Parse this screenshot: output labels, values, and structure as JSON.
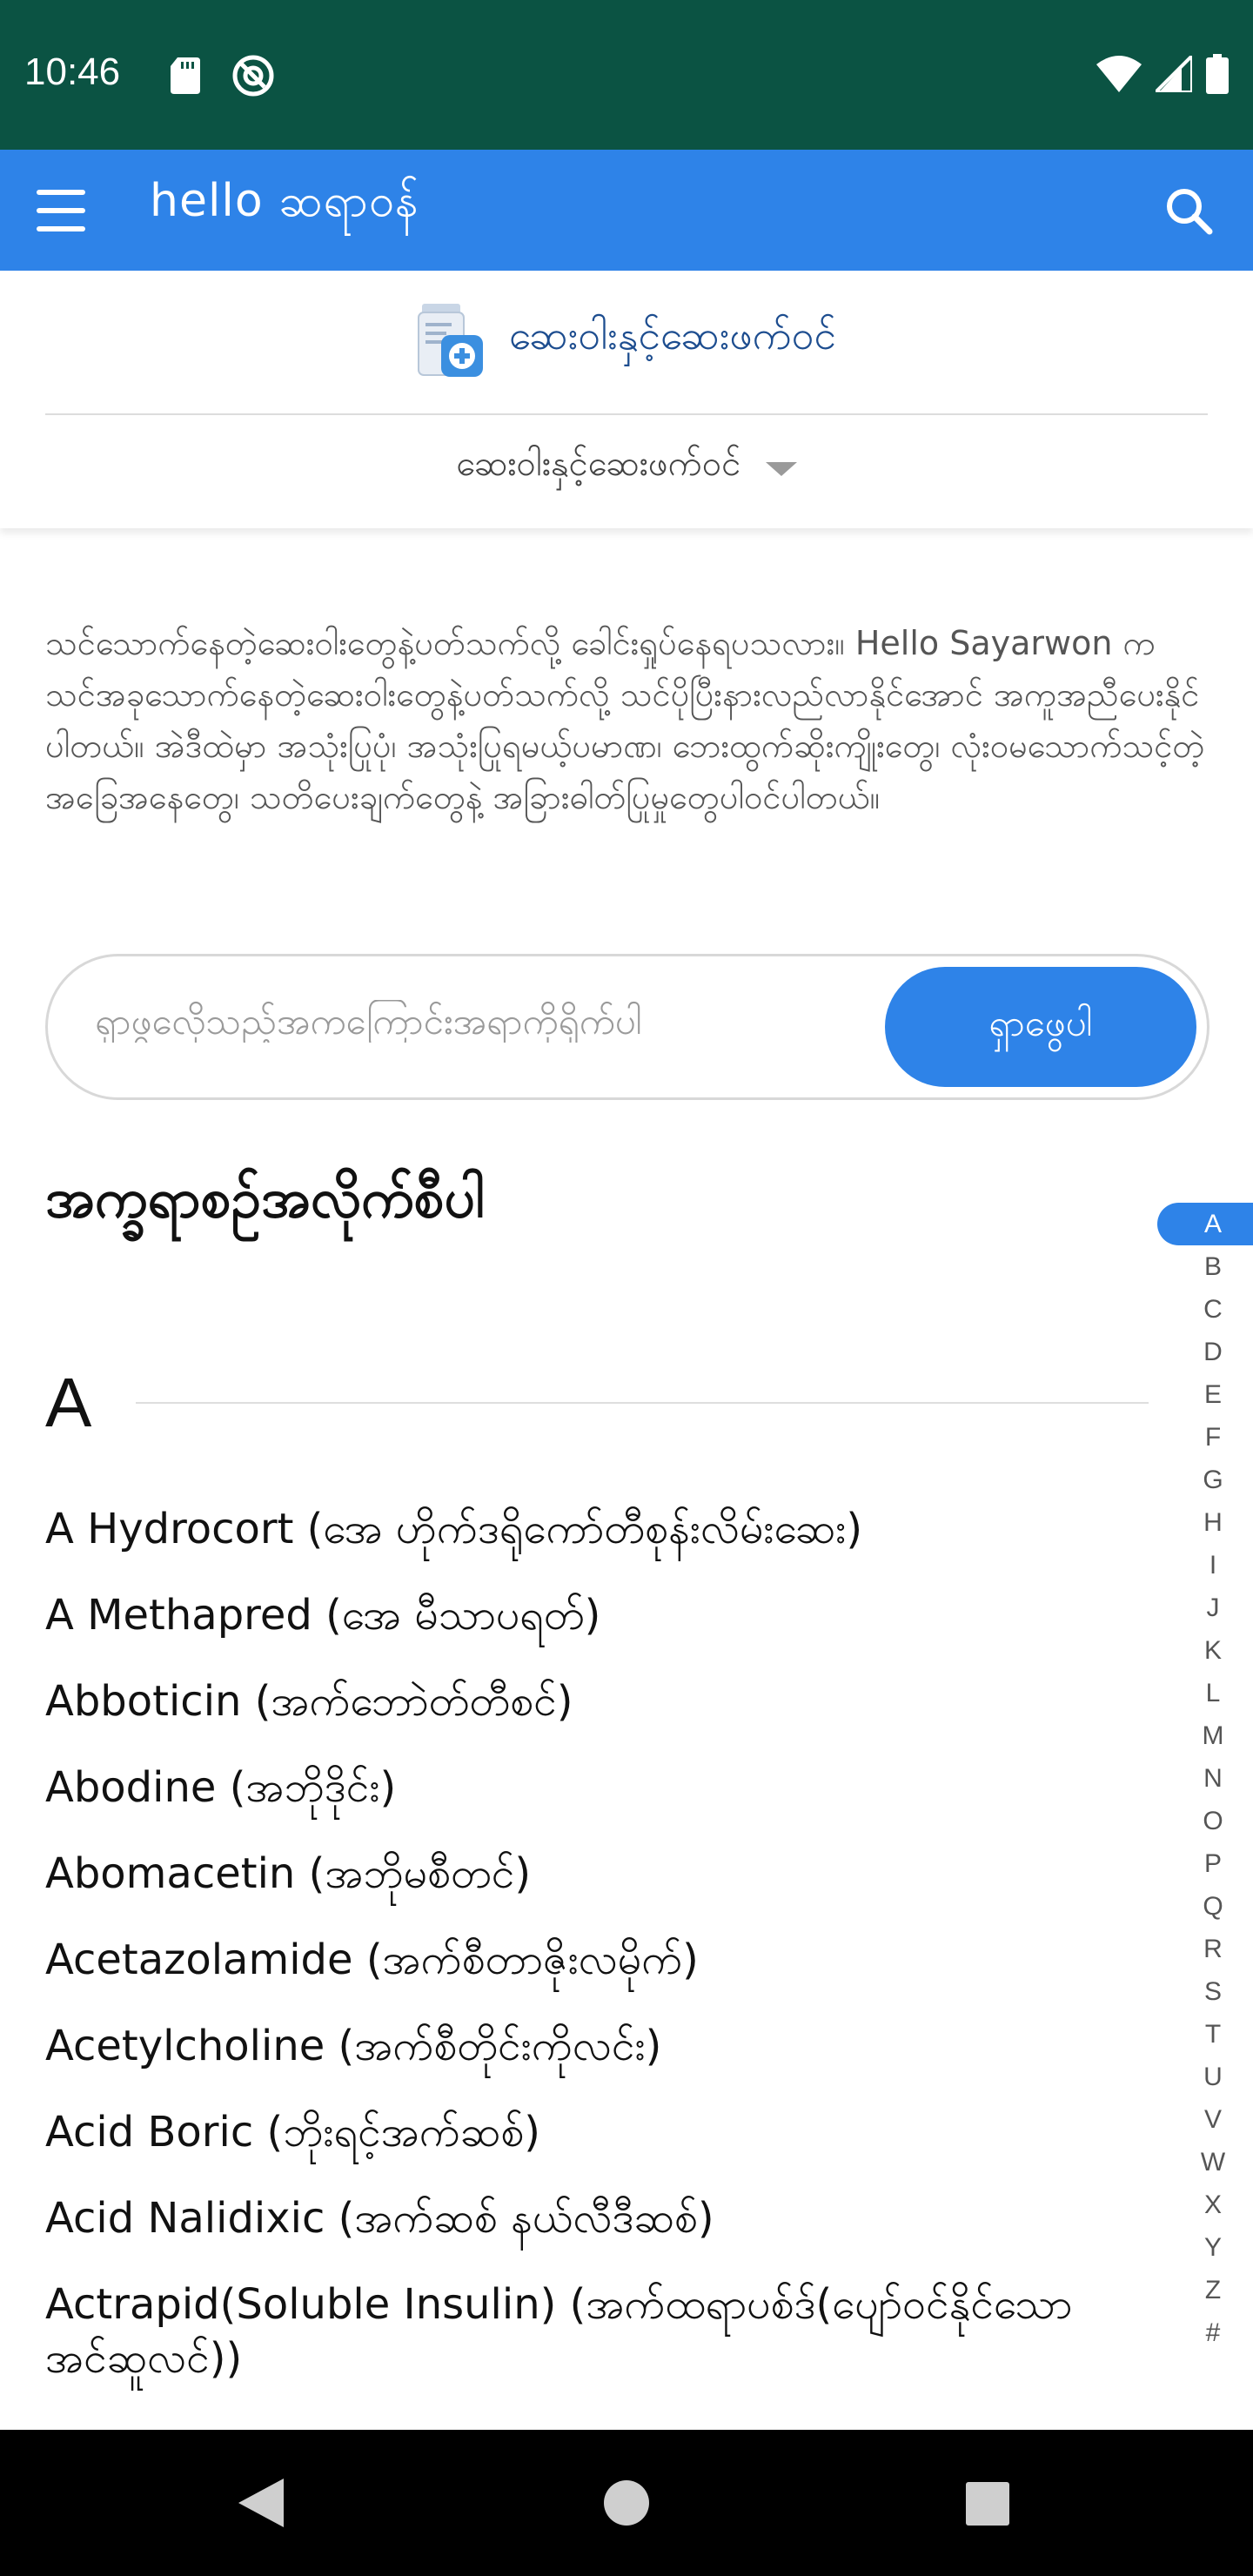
{
  "status_bar": {
    "time": "10:46",
    "icons": [
      "sd-card-icon",
      "app-notification-icon",
      "wifi-icon",
      "signal-icon",
      "battery-icon"
    ]
  },
  "app_bar": {
    "brand": "hello ဆရာဝန်",
    "icons": [
      "menu-icon",
      "search-icon"
    ]
  },
  "category": {
    "title": "ဆေးဝါးနှင့်ဆေးဖက်ဝင်",
    "dropdown_label": "ဆေးဝါးနှင့်ဆေးဖက်ဝင်"
  },
  "intro": {
    "text": "သင်သောက်နေတဲ့ဆေးဝါးတွေနဲ့ပတ်သက်လို့ ခေါင်းရှုပ်နေရပသလား။ Hello Sayarwon က သင်အခုသောက်နေတဲ့ဆေးဝါးတွေနဲ့ပတ်သက်လို့ သင်ပိုပြီးနားလည်လာနိုင်အောင် အကူအညီပေးနိုင်ပါတယ်။ အဲဒီထဲမှာ အသုံးပြုပုံ၊ အသုံးပြုရမယ့်ပမာဏ၊ ဘေးထွက်ဆိုးကျိုးတွေ၊ လုံးဝမသောက်သင့်တဲ့အခြေအနေတွေ၊ သတိပေးချက်တွေနဲ့ အခြားဓါတ်ပြုမှုတွေပါဝင်ပါတယ်။"
  },
  "search": {
    "placeholder": "ရှာဖွလေိုသည့်အကကြောင်းအရာကိုရိုက်ပါ",
    "button_label": "ရှာဖွေပါ"
  },
  "section_heading": "အက္ခရာစဉ်အလိုက်စီပါ",
  "current_letter": "A",
  "drugs": [
    "A Hydrocort (အေ ဟိုက်ဒရိုကော်တီစုန်းလိမ်းဆေး)",
    "A Methapred (အေ မီသာပရတ်)",
    "Abboticin (အက်ဘောဲတ်တီစင်)",
    "Abodine (အဘိုဒိုင်း)",
    "Abomacetin (အဘိုမစီတင်)",
    "Acetazolamide (အက်စီတာဇိုးလမိုက်)",
    "Acetylcholine (အက်စီတိုင်းကိုလင်း)",
    "Acid Boric (ဘိုးရင့်အက်ဆစ်)",
    "Acid Nalidixic (အက်ဆစ် နယ်လီဒီဆစ်)",
    "Actrapid(Soluble Insulin) (အက်ထရာပစ်ဒ်(ပျော်ဝင်နိုင်သောအင်ဆူလင်))"
  ],
  "alphabet": [
    "A",
    "B",
    "C",
    "D",
    "E",
    "F",
    "G",
    "H",
    "I",
    "J",
    "K",
    "L",
    "M",
    "N",
    "O",
    "P",
    "Q",
    "R",
    "S",
    "T",
    "U",
    "V",
    "W",
    "X",
    "Y",
    "Z",
    "#"
  ],
  "active_letter": "A",
  "colors": {
    "status_bar": "#0b5343",
    "primary": "#2e83e8",
    "category_title": "#1d4d8f",
    "nav_bar": "#000000"
  },
  "nav_bar": {
    "icons": [
      "back-icon",
      "home-icon",
      "recents-icon"
    ]
  }
}
